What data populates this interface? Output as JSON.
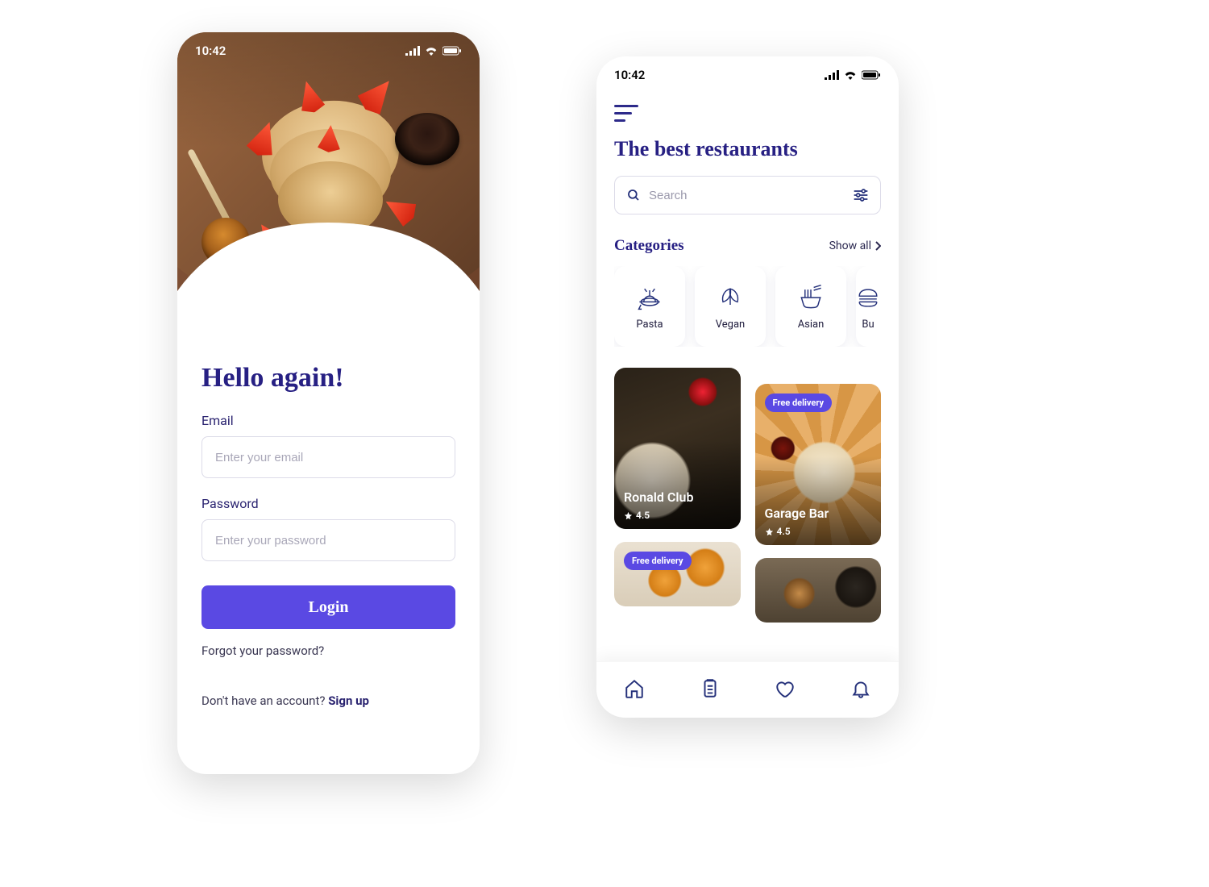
{
  "status": {
    "time": "10:42"
  },
  "login": {
    "title": "Hello again!",
    "email_label": "Email",
    "email_placeholder": "Enter your email",
    "password_label": "Password",
    "password_placeholder": "Enter your password",
    "login_button": "Login",
    "forgot": "Forgot your password?",
    "signup_prompt": "Don't have an account? ",
    "signup_action": "Sign up"
  },
  "home": {
    "title": "The best restaurants",
    "search_placeholder": "Search",
    "categories_title": "Categories",
    "show_all": "Show all",
    "categories": [
      {
        "label": "Pasta",
        "icon": "pasta"
      },
      {
        "label": "Vegan",
        "icon": "leaf"
      },
      {
        "label": "Asian",
        "icon": "noodles"
      },
      {
        "label": "Bu",
        "icon": "burger"
      }
    ],
    "badge_free_delivery": "Free delivery",
    "restaurants": [
      {
        "name": "Ronald Club",
        "rating": "4.5",
        "badge": null
      },
      {
        "name": "Garage Bar",
        "rating": "4.5",
        "badge": "Free delivery"
      },
      {
        "name": "",
        "rating": "",
        "badge": "Free delivery"
      },
      {
        "name": "",
        "rating": "",
        "badge": null
      }
    ]
  }
}
